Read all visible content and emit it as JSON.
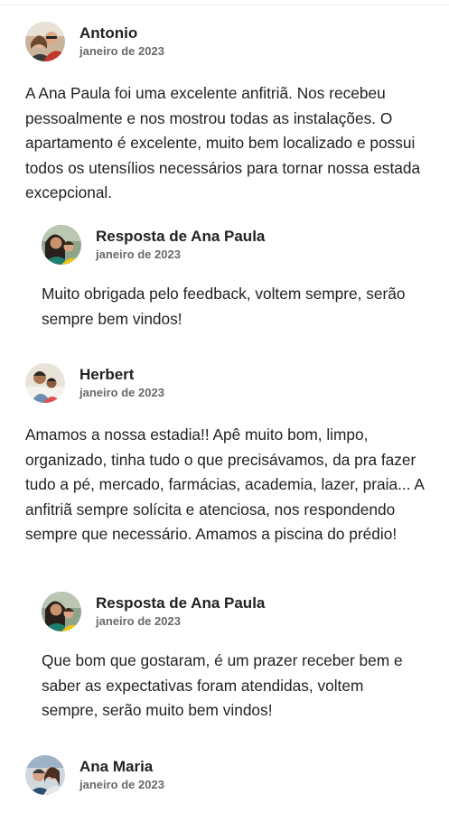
{
  "reviews": [
    {
      "name": "Antonio",
      "date": "janeiro de 2023",
      "text": "A Ana Paula foi uma excelente anfitriã. Nos recebeu pessoalmente e nos mostrou todas as instalações. O apartamento é excelente, muito bem localizado e possui todos os utensílios necessários para tornar nossa estada excepcional.",
      "response": {
        "title": "Resposta de Ana Paula",
        "date": "janeiro de 2023",
        "text": "Muito obrigada pelo feedback, voltem sempre, serão sempre bem vindos!"
      }
    },
    {
      "name": "Herbert",
      "date": "janeiro de 2023",
      "text": "Amamos a nossa estadia!! Apê muito bom, limpo, organizado, tinha tudo o que precisávamos, da pra fazer tudo a pé, mercado, farmácias, academia, lazer, praia... A anfitriã sempre solícita e atenciosa, nos respondendo sempre que necessário. Amamos a piscina do prédio!",
      "response": {
        "title": "Resposta de Ana Paula",
        "date": "janeiro de 2023",
        "text": "Que bom que gostaram, é um prazer receber bem e saber as expectativas foram atendidas, voltem sempre, serão muito bem vindos!"
      }
    },
    {
      "name": "Ana Maria",
      "date": "janeiro de 2023"
    }
  ]
}
